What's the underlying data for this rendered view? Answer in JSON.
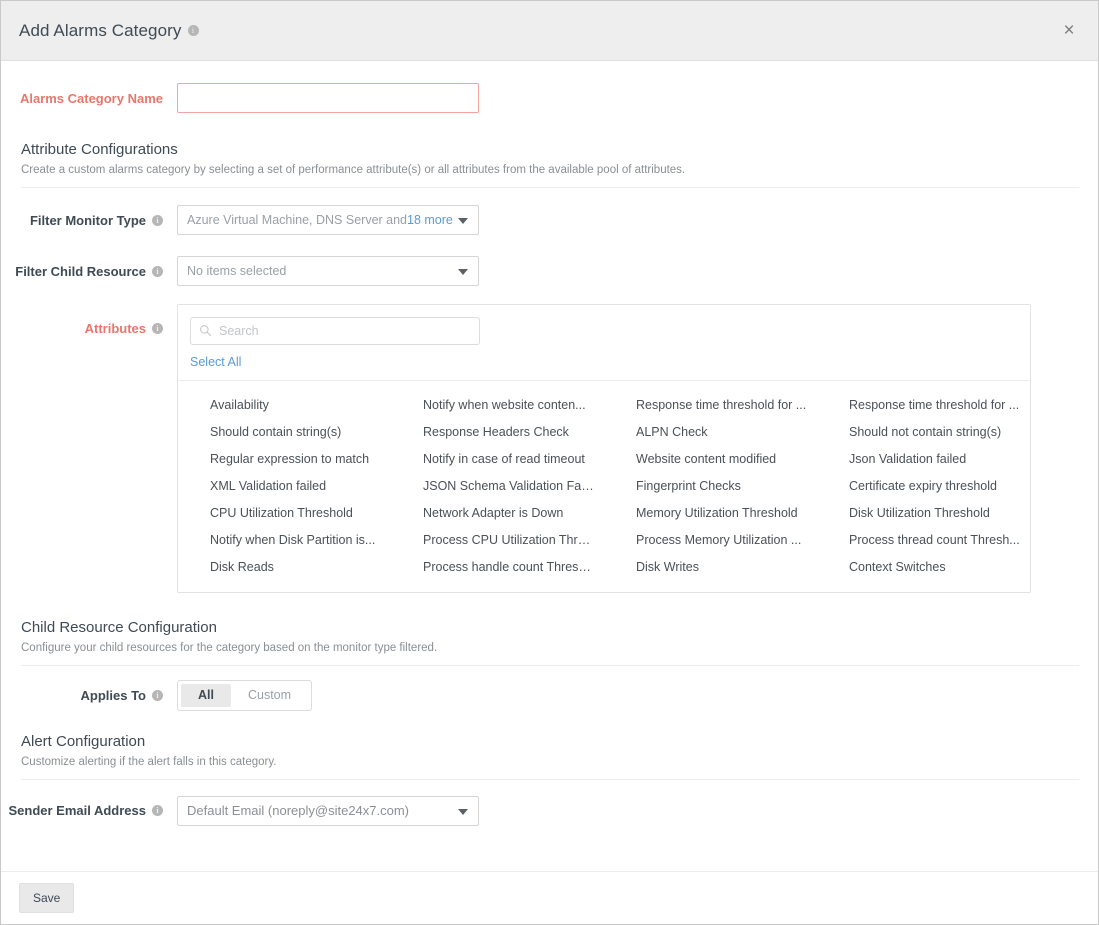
{
  "header": {
    "title": "Add Alarms Category",
    "info_icon": "info-icon",
    "close_icon": "×"
  },
  "name_field": {
    "label": "Alarms Category Name",
    "value": "",
    "placeholder": ""
  },
  "attribute_configurations": {
    "title": "Attribute Configurations",
    "description": "Create a custom alarms category by selecting a set of performance attribute(s) or all attributes from the available pool of attributes.",
    "filter_monitor_type": {
      "label": "Filter Monitor Type",
      "value_prefix": "Azure Virtual Machine, DNS Server and ",
      "value_link": "18 more"
    },
    "filter_child_resource": {
      "label": "Filter Child Resource",
      "value": "No items selected"
    },
    "attributes": {
      "label": "Attributes",
      "search_placeholder": "Search",
      "search_value": "",
      "select_all_label": "Select All",
      "items": [
        "Availability",
        "Notify when website conten...",
        "Response time threshold for ...",
        "Response time threshold for ...",
        "Should contain string(s)",
        "Response Headers Check",
        "ALPN Check",
        "Should not contain string(s)",
        "Regular expression to match",
        "Notify in case of read timeout",
        "Website content modified",
        "Json Validation failed",
        "XML Validation failed",
        "JSON Schema Validation Fail...",
        "Fingerprint Checks",
        "Certificate expiry threshold",
        "CPU Utilization Threshold",
        "Network Adapter is Down",
        "Memory Utilization Threshold",
        "Disk Utilization Threshold",
        "Notify when Disk Partition is...",
        "Process CPU Utilization Thre...",
        "Process Memory Utilization ...",
        "Process thread count Thresh...",
        "Disk Reads",
        "Process handle count Thresh...",
        "Disk Writes",
        "Context Switches"
      ]
    }
  },
  "child_resource_configuration": {
    "title": "Child Resource Configuration",
    "description": "Configure your child resources for the category based on the monitor type filtered.",
    "applies_to": {
      "label": "Applies To",
      "options": [
        "All",
        "Custom"
      ],
      "selected": "All"
    }
  },
  "alert_configuration": {
    "title": "Alert Configuration",
    "description": "Customize alerting if the alert falls in this category.",
    "sender_email": {
      "label": "Sender Email Address",
      "value": "Default Email (noreply@site24x7.com)"
    }
  },
  "footer": {
    "save_label": "Save"
  },
  "colors": {
    "header_bg": "#eeeeee",
    "required_red": "#e8776b",
    "link_blue": "#5b9bd5",
    "text": "#3f4a54"
  }
}
